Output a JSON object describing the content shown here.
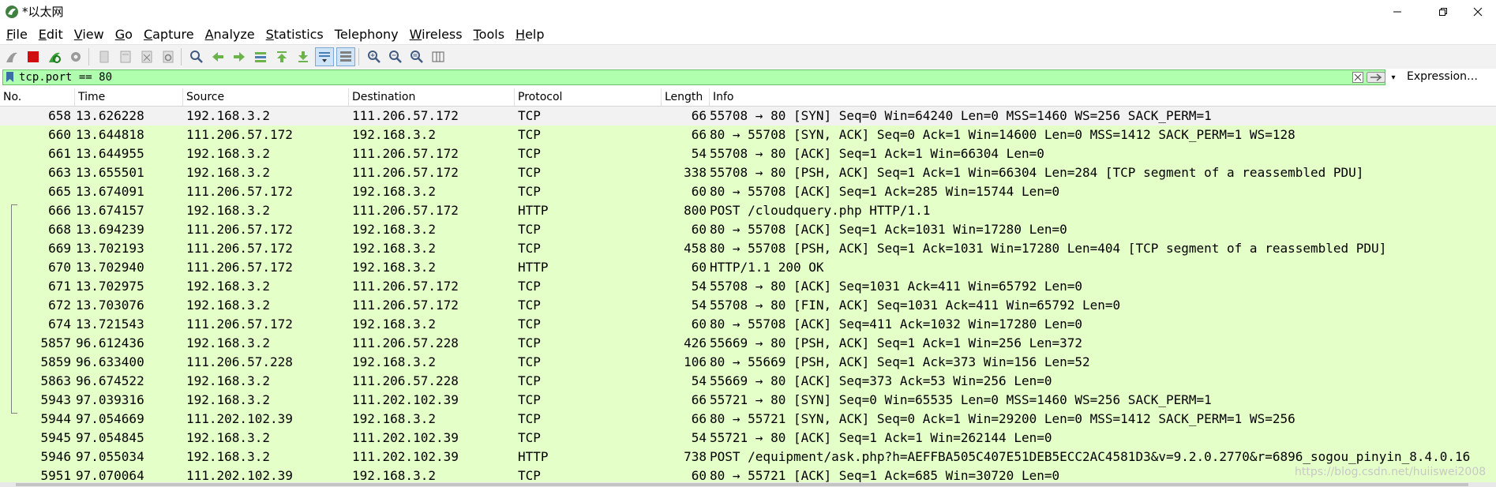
{
  "window": {
    "title": "*以太网",
    "controls": {
      "minimize": "—",
      "maximize": "❐",
      "close": "✕"
    }
  },
  "menu": [
    {
      "ak": "F",
      "rest": "ile"
    },
    {
      "ak": "E",
      "rest": "dit"
    },
    {
      "ak": "V",
      "rest": "iew"
    },
    {
      "ak": "G",
      "rest": "o"
    },
    {
      "ak": "C",
      "rest": "apture"
    },
    {
      "ak": "A",
      "rest": "nalyze"
    },
    {
      "ak": "S",
      "rest": "tatistics"
    },
    {
      "ak": "",
      "rest": "Telephony"
    },
    {
      "ak": "W",
      "rest": "ireless"
    },
    {
      "ak": "T",
      "rest": "ools"
    },
    {
      "ak": "H",
      "rest": "elp"
    }
  ],
  "filter": {
    "value": "tcp.port == 80",
    "expression_label": "Expression…",
    "dropdown_glyph": "▾"
  },
  "columns": {
    "no": "No.",
    "time": "Time",
    "source": "Source",
    "destination": "Destination",
    "protocol": "Protocol",
    "length": "Length",
    "info": "Info"
  },
  "packets": [
    {
      "no": "658",
      "time": "13.626228",
      "src": "192.168.3.2",
      "dst": "111.206.57.172",
      "proto": "TCP",
      "len": "66",
      "info": "55708 → 80 [SYN] Seq=0 Win=64240 Len=0 MSS=1460 WS=256 SACK_PERM=1",
      "selected": true
    },
    {
      "no": "660",
      "time": "13.644818",
      "src": "111.206.57.172",
      "dst": "192.168.3.2",
      "proto": "TCP",
      "len": "66",
      "info": "80 → 55708 [SYN, ACK] Seq=0 Ack=1 Win=14600 Len=0 MSS=1412 SACK_PERM=1 WS=128"
    },
    {
      "no": "661",
      "time": "13.644955",
      "src": "192.168.3.2",
      "dst": "111.206.57.172",
      "proto": "TCP",
      "len": "54",
      "info": "55708 → 80 [ACK] Seq=1 Ack=1 Win=66304 Len=0"
    },
    {
      "no": "663",
      "time": "13.655501",
      "src": "192.168.3.2",
      "dst": "111.206.57.172",
      "proto": "TCP",
      "len": "338",
      "info": "55708 → 80 [PSH, ACK] Seq=1 Ack=1 Win=66304 Len=284 [TCP segment of a reassembled PDU]"
    },
    {
      "no": "665",
      "time": "13.674091",
      "src": "111.206.57.172",
      "dst": "192.168.3.2",
      "proto": "TCP",
      "len": "60",
      "info": "80 → 55708 [ACK] Seq=1 Ack=285 Win=15744 Len=0"
    },
    {
      "no": "666",
      "time": "13.674157",
      "src": "192.168.3.2",
      "dst": "111.206.57.172",
      "proto": "HTTP",
      "len": "800",
      "info": "POST /cloudquery.php HTTP/1.1"
    },
    {
      "no": "668",
      "time": "13.694239",
      "src": "111.206.57.172",
      "dst": "192.168.3.2",
      "proto": "TCP",
      "len": "60",
      "info": "80 → 55708 [ACK] Seq=1 Ack=1031 Win=17280 Len=0"
    },
    {
      "no": "669",
      "time": "13.702193",
      "src": "111.206.57.172",
      "dst": "192.168.3.2",
      "proto": "TCP",
      "len": "458",
      "info": "80 → 55708 [PSH, ACK] Seq=1 Ack=1031 Win=17280 Len=404 [TCP segment of a reassembled PDU]"
    },
    {
      "no": "670",
      "time": "13.702940",
      "src": "111.206.57.172",
      "dst": "192.168.3.2",
      "proto": "HTTP",
      "len": "60",
      "info": "HTTP/1.1 200 OK"
    },
    {
      "no": "671",
      "time": "13.702975",
      "src": "192.168.3.2",
      "dst": "111.206.57.172",
      "proto": "TCP",
      "len": "54",
      "info": "55708 → 80 [ACK] Seq=1031 Ack=411 Win=65792 Len=0"
    },
    {
      "no": "672",
      "time": "13.703076",
      "src": "192.168.3.2",
      "dst": "111.206.57.172",
      "proto": "TCP",
      "len": "54",
      "info": "55708 → 80 [FIN, ACK] Seq=1031 Ack=411 Win=65792 Len=0"
    },
    {
      "no": "674",
      "time": "13.721543",
      "src": "111.206.57.172",
      "dst": "192.168.3.2",
      "proto": "TCP",
      "len": "60",
      "info": "80 → 55708 [ACK] Seq=411 Ack=1032 Win=17280 Len=0"
    },
    {
      "no": "5857",
      "time": "96.612436",
      "src": "192.168.3.2",
      "dst": "111.206.57.228",
      "proto": "TCP",
      "len": "426",
      "info": "55669 → 80 [PSH, ACK] Seq=1 Ack=1 Win=256 Len=372"
    },
    {
      "no": "5859",
      "time": "96.633400",
      "src": "111.206.57.228",
      "dst": "192.168.3.2",
      "proto": "TCP",
      "len": "106",
      "info": "80 → 55669 [PSH, ACK] Seq=1 Ack=373 Win=156 Len=52"
    },
    {
      "no": "5863",
      "time": "96.674522",
      "src": "192.168.3.2",
      "dst": "111.206.57.228",
      "proto": "TCP",
      "len": "54",
      "info": "55669 → 80 [ACK] Seq=373 Ack=53 Win=256 Len=0"
    },
    {
      "no": "5943",
      "time": "97.039316",
      "src": "192.168.3.2",
      "dst": "111.202.102.39",
      "proto": "TCP",
      "len": "66",
      "info": "55721 → 80 [SYN] Seq=0 Win=65535 Len=0 MSS=1460 WS=256 SACK_PERM=1"
    },
    {
      "no": "5944",
      "time": "97.054669",
      "src": "111.202.102.39",
      "dst": "192.168.3.2",
      "proto": "TCP",
      "len": "66",
      "info": "80 → 55721 [SYN, ACK] Seq=0 Ack=1 Win=29200 Len=0 MSS=1412 SACK_PERM=1 WS=256"
    },
    {
      "no": "5945",
      "time": "97.054845",
      "src": "192.168.3.2",
      "dst": "111.202.102.39",
      "proto": "TCP",
      "len": "54",
      "info": "55721 → 80 [ACK] Seq=1 Ack=1 Win=262144 Len=0"
    },
    {
      "no": "5946",
      "time": "97.055034",
      "src": "192.168.3.2",
      "dst": "111.202.102.39",
      "proto": "HTTP",
      "len": "738",
      "info": "POST /equipment/ask.php?h=AEFFBA505C407E51DEB5ECC2AC4581D3&v=9.2.0.2770&r=6896_sogou_pinyin_8.4.0.16"
    },
    {
      "no": "5951",
      "time": "97.070064",
      "src": "111.202.102.39",
      "dst": "192.168.3.2",
      "proto": "TCP",
      "len": "60",
      "info": "80 → 55721 [ACK] Seq=1 Ack=685 Win=30720 Len=0"
    }
  ],
  "watermark": "https://blog.csdn.net/huiiswei2008",
  "colors": {
    "tcp_row": "#e4ffc7",
    "selected_row": "#f2f2f2",
    "filter_valid": "#afffaf"
  }
}
